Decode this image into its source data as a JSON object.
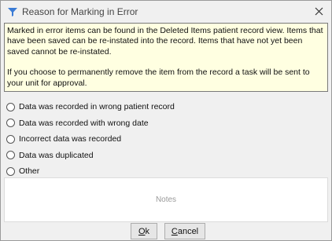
{
  "window": {
    "title": "Reason for Marking in Error",
    "icon": "funnel-app-icon",
    "close_icon": "close-icon"
  },
  "notice": {
    "paragraph1": "Marked in error items can be found in the Deleted Items patient record view. Items that have been saved can be re-instated into the record. Items that have not yet been saved cannot be re-instated.",
    "paragraph2": "If you choose to permanently remove the item from the record a task will be sent to your unit for approval.",
    "background_color": "#ffffe1"
  },
  "options": [
    {
      "label": "Data was recorded in wrong patient record"
    },
    {
      "label": "Data was recorded with wrong date"
    },
    {
      "label": "Incorrect data was recorded"
    },
    {
      "label": "Data was duplicated"
    },
    {
      "label": "Other"
    }
  ],
  "notes": {
    "placeholder": "Notes",
    "value": ""
  },
  "buttons": {
    "ok_mnemonic": "O",
    "ok_rest": "k",
    "cancel_mnemonic": "C",
    "cancel_rest": "ancel"
  }
}
